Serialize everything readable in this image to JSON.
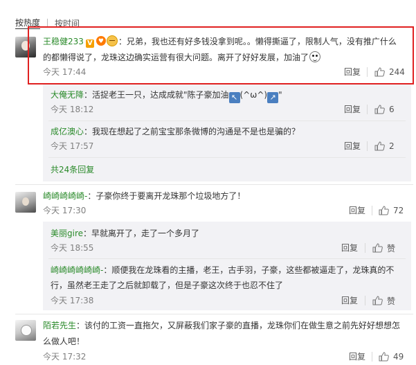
{
  "sort": {
    "hot": "按热度",
    "time": "按时间"
  },
  "comments": [
    {
      "user": "王稳健233",
      "line1": "：兄弟，我也还有好多钱没拿到呢。。懒得撕逼了，限制人气，没有推广什么",
      "line2": "的都懒得说了，龙珠这边确实运营有很大问题。离开了好好发展，加油了",
      "time": "今天 17:44",
      "reply": "回复",
      "likes": "244",
      "subs": [
        {
          "user": "大俺无降",
          "text": "：活捉老王一只，达成成就\"陈子豪加油",
          "text2": "(^ω^)",
          "text3": "\"",
          "time": "今天 18:12",
          "reply": "回复",
          "likes": "6"
        },
        {
          "user": "成亿澳心",
          "text": "：我现在想起了之前宝宝那条微博的沟通是不是也是骗的？",
          "time": "今天 17:57",
          "reply": "回复",
          "likes": "2"
        }
      ],
      "more": "共24条回复"
    },
    {
      "user": "崎崎崎崎崎-",
      "line1": "：子豪你终于要离开龙珠那个垃圾地方了！",
      "time": "今天 17:30",
      "reply": "回复",
      "likes": "72",
      "subs": [
        {
          "user": "美丽gire",
          "text": "：早就离开了，走了一个多月了",
          "time": "今天 18:55",
          "reply": "回复",
          "likes": "赞"
        },
        {
          "user": "崎崎崎崎崎崎-",
          "text": "：顺便我在龙珠看的主播，老王，古手羽，子豪，这些都被逼走了，龙珠真的不",
          "text2": "行，虽然老王走了之后就卸载了，但是子豪这次终于也忍不住了",
          "time": "今天 17:38",
          "reply": "回复",
          "likes": "赞"
        }
      ]
    },
    {
      "user": "陌若先生",
      "line1": "：该付的工资一直拖欠，又屏蔽我们家子豪的直播，龙珠你们在做生意之前先好好想想怎",
      "line2": "么做人吧！",
      "time": "今天 17:32",
      "reply": "回复",
      "likes": "49"
    }
  ],
  "colors": {
    "username": "#2a8a2a",
    "highlight": "#e02020",
    "subBg": "#f2f2f5"
  }
}
